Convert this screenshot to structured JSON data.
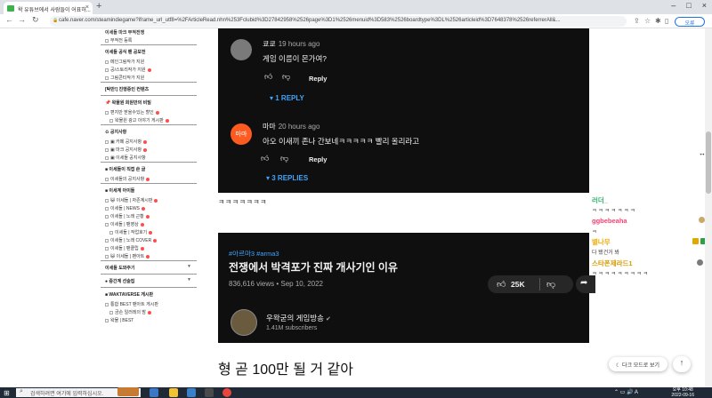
{
  "browser": {
    "tab_title": "왁 유튜브에서 사람들이 어표하...",
    "tab_close": "×",
    "newtab": "+",
    "win_controls": [
      "–",
      "□",
      "×"
    ],
    "url": "cafe.naver.com/steamindiegame?iframe_url_utf8=%2FArticleRead.nhn%253Fclubid%3D27842958%2526page%3D1%2526menuid%3D583%2526boardtype%3DL%2526articleid%3D7648378%2526referrerAll&...",
    "profile_label": "오류"
  },
  "sidebar": {
    "sections": [
      {
        "title": "",
        "items": [
          {
            "label": "이세돌 마크 부적전쟁",
            "bold": true
          },
          {
            "label": "부적전 등록",
            "box": true
          }
        ]
      },
      {
        "title": "이세돌 공식 팬 공모전",
        "items": [
          {
            "label": "메인그림작가 지원",
            "box": true
          },
          {
            "label": "공/스토리작가 지원",
            "box": true,
            "new": true
          },
          {
            "label": "그림콘티작가 지원",
            "box": true
          }
        ]
      },
      {
        "title": "[탁만!] 진행중인 컨텐츠",
        "items": []
      },
      {
        "title": "📌 왁물원 회원만의 비밀",
        "items": [
          {
            "label": "편지만 받을수있는 할인",
            "box": true,
            "new": true
          },
          {
            "label": "왁물원 광고 이야기 게시판",
            "box": true,
            "new": true,
            "indent": true
          }
        ]
      },
      {
        "title": "♻ 공지사항",
        "items": [
          {
            "label": "▣ 카페 공지사항",
            "box": true,
            "new": true
          },
          {
            "label": "▣ 마크 공지사항",
            "box": true,
            "new": true
          },
          {
            "label": "▣ 이세돌 공지사항",
            "box": true
          }
        ]
      },
      {
        "title": "■ 이세돌이 직접 쓴 글",
        "items": [
          {
            "label": "이세돌의 공지사항",
            "box": true,
            "new": true
          }
        ]
      },
      {
        "title": "■ 이세계 아이돌",
        "items": [
          {
            "label": "😺 이세돌 | 자존계시판",
            "box": true,
            "new": true
          },
          {
            "label": "이세돌 | NEWS",
            "box": true,
            "new": true
          },
          {
            "label": "이세돌 | 노래 근황",
            "box": true,
            "new": true
          },
          {
            "label": "이세돌 | 팬영상",
            "box": true,
            "new": true
          },
          {
            "label": "이세돌 | 작업호기",
            "box": true,
            "new": true,
            "indent": true
          },
          {
            "label": "이세돌 | 노래 COVER",
            "box": true,
            "new": true
          },
          {
            "label": "이세돌 | 팬클립",
            "box": true,
            "new": true
          },
          {
            "label": "😺 이세돌 | 팬아트",
            "box": true,
            "new": true
          }
        ]
      },
      {
        "title": "이세돌 도와주기",
        "arrow": true,
        "items": []
      },
      {
        "title": "● 중간계 선술집",
        "arrow": true,
        "items": []
      },
      {
        "title": "■ WAKTAVERSE 게시판",
        "items": [
          {
            "label": "통합 BEST 팬아트 게시판",
            "box": true
          },
          {
            "label": "금손 일러레의 밤",
            "box": true,
            "new": true,
            "indent": true
          },
          {
            "label": "왁물 | BEST",
            "box": true
          }
        ]
      }
    ]
  },
  "comments": [
    {
      "author": "쿄쿄",
      "time": "19 hours ago",
      "text": "게임 이름이 몬가여?",
      "reply_label": "Reply",
      "replies": "1 REPLY",
      "avatar_color": "#7a7a7a"
    },
    {
      "author": "마마",
      "time": "20 hours ago",
      "text": "아오 이새끼 존나 간보네ㅋㅋㅋㅋㅋ 빨리 올리라고",
      "reply_label": "Reply",
      "replies": "3 REPLIES",
      "avatar_color": "#ff5a1f",
      "avatar_text": "마마"
    }
  ],
  "kkk_text": "ㅋㅋㅋㅋㅋㅋㅋ",
  "video": {
    "tags": "#아르마3 #arma3",
    "title": "전쟁에서 박격포가 진짜 개사기인 이유",
    "meta": "836,616 views • Sep 10, 2022",
    "like_count": "25K",
    "channel": "우왁굳의 게임방송",
    "verified_icon": "✔",
    "subscribers": "1.41M subscribers"
  },
  "big_comment": "형 곧 100만 될 거 같아",
  "chat": [
    {
      "name": "러더_",
      "color": "#3cb371",
      "sub": "ㅋ ㅋ ㅋ ㅋ ㅋ ㅋ ㅋ"
    },
    {
      "name": "ggbebeaha",
      "color": "#ff3d6e",
      "sub": "ㅋ"
    },
    {
      "name": "별나무",
      "color": "#f2a900",
      "sub": "다 됐건거 봐"
    },
    {
      "name": "스타폰제라드1",
      "color": "#d39b00",
      "sub": "ㅋ ㅋ ㅋ ㅋ ㅋ ㅋ ㅋ ㅋ ㅋ"
    }
  ],
  "darkmode_label": "다크 모드로 보기",
  "totop_label": "↑",
  "taskbar": {
    "search_placeholder": "검색하려면 여기에 입력하십시오.",
    "clock_time": "오후 10:48",
    "clock_date": "2022-09-16"
  }
}
